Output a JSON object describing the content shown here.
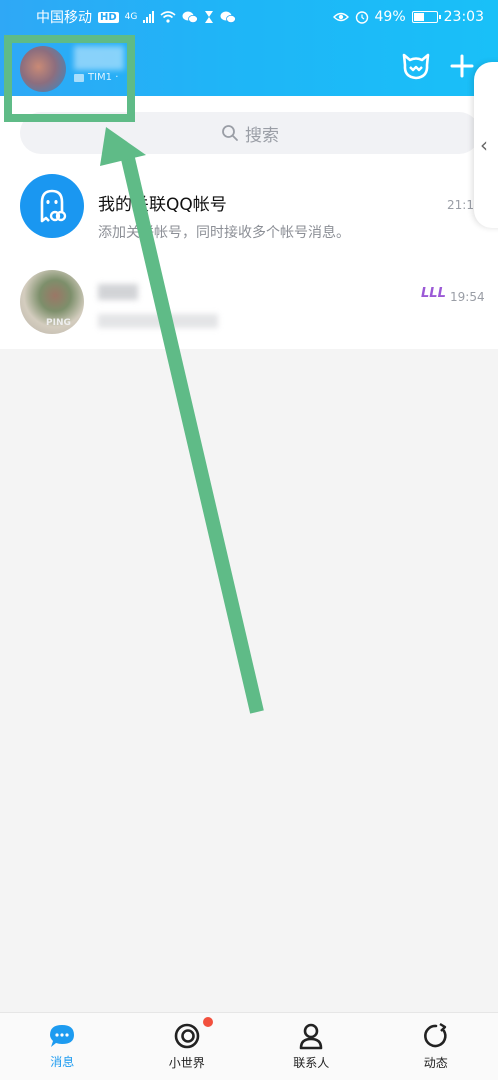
{
  "status_bar": {
    "carrier": "中国移动",
    "hd": "HD",
    "network": "4G",
    "battery": "49%",
    "battery_level": 0.49,
    "time": "23:03"
  },
  "header": {
    "status_text": "TIM1 ·"
  },
  "search": {
    "placeholder": "搜索"
  },
  "conversations": [
    {
      "title": "我的关联QQ帐号",
      "subtitle": "添加关联帐号，同时接收多个帐号消息。",
      "time": "21:13"
    },
    {
      "badge": "LLL",
      "time": "19:54",
      "avatar_text": "PING"
    }
  ],
  "bottom_nav": [
    {
      "label": "消息",
      "icon": "message-icon",
      "active": true
    },
    {
      "label": "小世界",
      "icon": "small-world-icon",
      "active": false,
      "has_dot": true
    },
    {
      "label": "联系人",
      "icon": "contacts-icon",
      "active": false
    },
    {
      "label": "动态",
      "icon": "feed-icon",
      "active": false
    }
  ],
  "colors": {
    "header_blue": "#1fb5f7",
    "accent_blue": "#1d9bf0",
    "highlight_green": "#5fbb87",
    "badge_red": "#f2503d"
  }
}
